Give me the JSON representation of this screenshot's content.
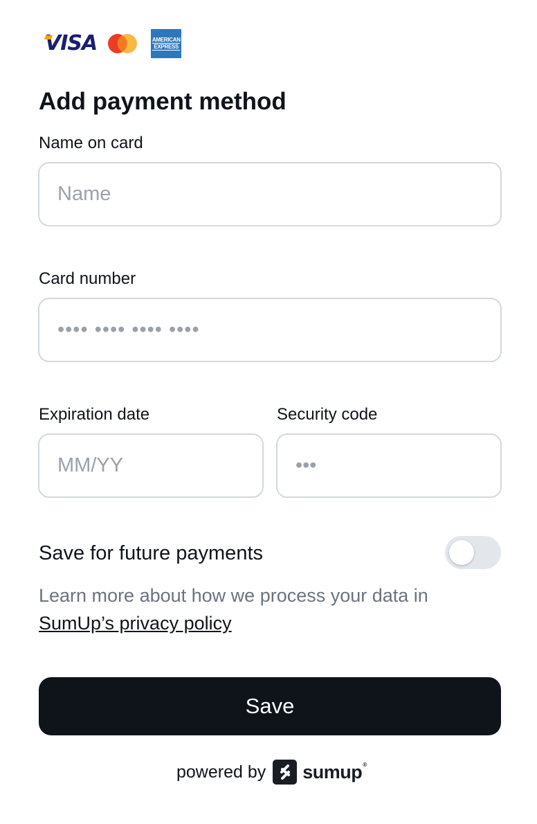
{
  "card_brands": {
    "visa": "VISA",
    "mastercard": "mastercard",
    "amex_line1": "AMERICAN",
    "amex_line2": "EXPRESS"
  },
  "title": "Add payment method",
  "fields": {
    "name": {
      "label": "Name on card",
      "placeholder": "Name",
      "value": ""
    },
    "card_number": {
      "label": "Card number",
      "placeholder": "•••• •••• •••• ••••",
      "value": ""
    },
    "expiration": {
      "label": "Expiration date",
      "placeholder": "MM/YY",
      "value": ""
    },
    "security_code": {
      "label": "Security code",
      "placeholder": "•••",
      "value": ""
    }
  },
  "save_future": {
    "label": "Save for future payments",
    "enabled": false
  },
  "privacy": {
    "text": "Learn more about how we process your data in ",
    "link": "SumUp’s privacy policy"
  },
  "save_button": "Save",
  "footer": {
    "powered_by": "powered by",
    "brand": "sumup"
  },
  "colors": {
    "primary": "#0f131a",
    "border": "#d3d8de",
    "placeholder": "#9aa1ab",
    "muted_text": "#6a737e",
    "toggle_off": "#e3e7ec"
  }
}
